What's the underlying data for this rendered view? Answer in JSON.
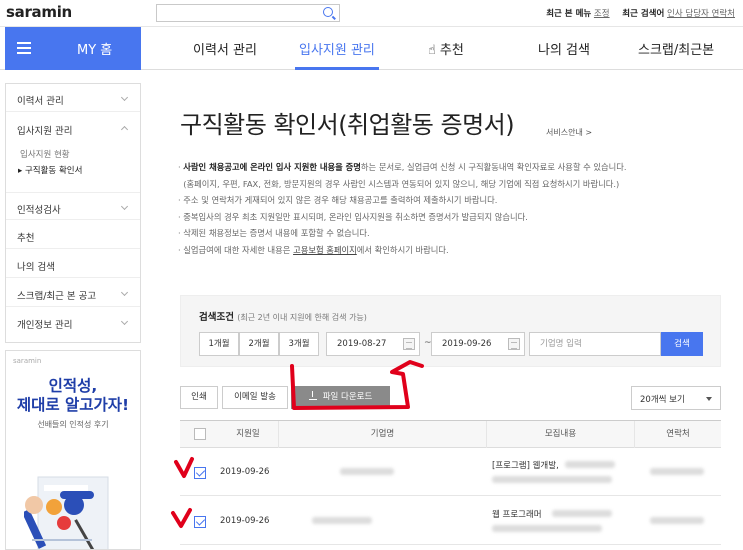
{
  "topbar": {
    "logo_text": "saramin",
    "links": [
      {
        "label": "최근 본 메뉴",
        "action": "조정"
      },
      {
        "label": "최근 검색어",
        "action": "인사 담당자 연락처"
      }
    ]
  },
  "gnb": {
    "home_label": "MY 홈",
    "menus": [
      "이력서 관리",
      "입사지원 관리",
      "추천",
      "나의 검색",
      "스크랩/최근본"
    ]
  },
  "sidebar": {
    "items": [
      {
        "label": "이력서 관리"
      },
      {
        "label": "입사지원 관리"
      },
      {
        "label": "인적성검사"
      },
      {
        "label": "추천"
      },
      {
        "label": "나의 검색"
      },
      {
        "label": "스크랩/최근 본 공고"
      },
      {
        "label": "개인정보 관리"
      }
    ],
    "subitems": [
      "입사지원 현황",
      "▸ 구직활동 확인서"
    ]
  },
  "banner": {
    "brand": "saramin",
    "headline_1": "인적성,",
    "headline_2": "제대로 알고가자!",
    "sub": "선배들의 인적성 후기"
  },
  "main": {
    "title": "구직활동 확인서(취업활동 증명서)",
    "service_link": "서비스안내 >",
    "notes": [
      {
        "bold": "사람인 채용공고에 온라인 입사 지원한 내용을 증명",
        "rest": "하는 문서로, 실업급여 신청 시 구직활동내역 확인자료로 사용할 수 있습니다."
      },
      {
        "bold": "",
        "rest": "(홈페이지, 우편, FAX, 전화, 방문지원의 경우 사람인 시스템과 연동되어 있지 않으니, 해당 기업에 직접 요청하시기 바랍니다.)"
      },
      {
        "bold": "",
        "rest": "주소 및 연락처가 게재되어 있지 않은 경우 해당 채용공고를 출력하여 제출하시기 바랍니다."
      },
      {
        "bold": "",
        "rest": "중복입사의 경우 최초 지원일만 표시되며, 온라인 입사지원을 취소하면 증명서가 발급되지 않습니다."
      },
      {
        "bold": "",
        "rest": "삭제된 채용정보는 증명서 내용에 포함할 수 없습니다."
      }
    ],
    "note_last_prefix": "실업급여에 대한 자세한 내용은 ",
    "note_last_link": "고용보험 홈페이지",
    "note_last_suffix": "에서 확인하시기 바랍니다."
  },
  "filter": {
    "label": "검색조건",
    "label_hint": "(최근 2년 이내 지원에 한해 검색 가능)",
    "periods": [
      "1개월",
      "2개월",
      "3개월"
    ],
    "date_from": "2019-08-27",
    "date_to": "2019-09-26",
    "tilde": "~",
    "company_placeholder": "기업명 입력",
    "search_label": "검색"
  },
  "actions": {
    "print": "인쇄",
    "email": "이메일 발송",
    "download": "파일 다운로드",
    "view_select": "20개씩 보기"
  },
  "table": {
    "headers": [
      "지원일",
      "기업명",
      "모집내용",
      "연락처"
    ],
    "rows": [
      {
        "date": "2019-09-26",
        "title": "[프로그램] 웹개발,",
        "checked": true
      },
      {
        "date": "2019-09-26",
        "title": "웹 프로그래머",
        "checked": true
      }
    ]
  },
  "colors": {
    "accent": "#4876ef",
    "annotation": "#e0001b"
  }
}
